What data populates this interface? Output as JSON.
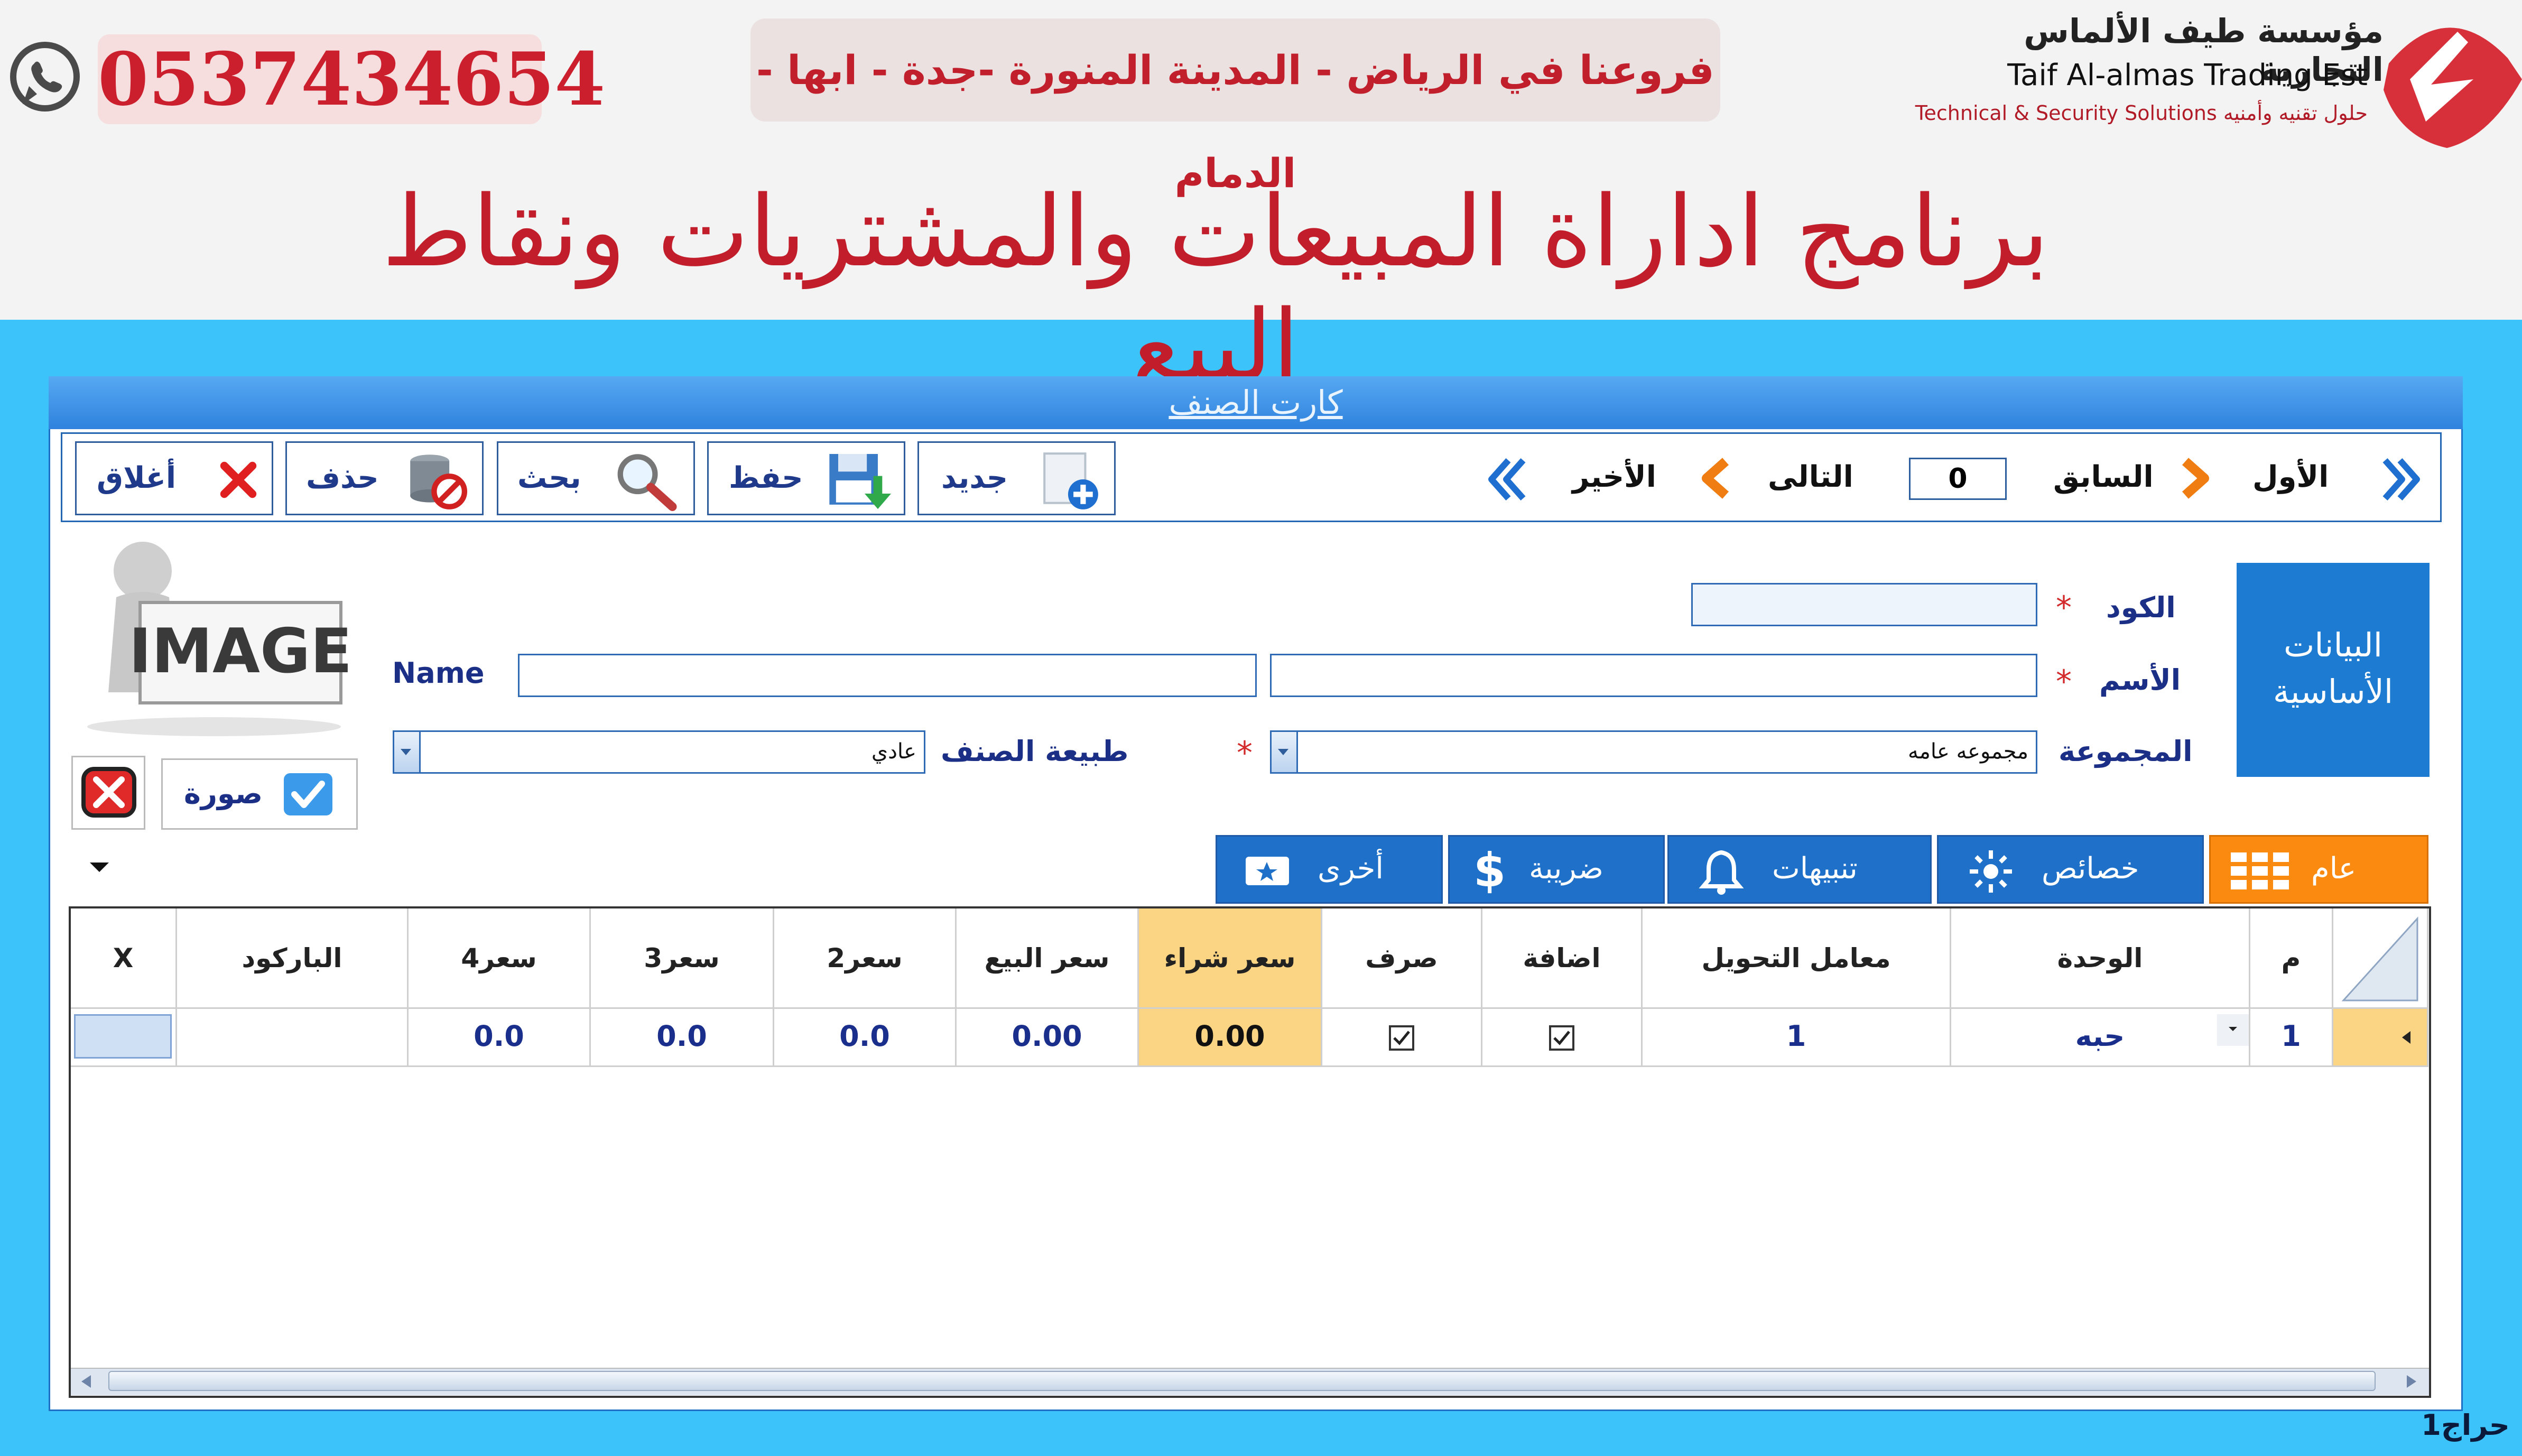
{
  "header": {
    "phone": "0537434654",
    "branches": "فروعنا في الرياض - المدينة المنورة -جدة - ابها - الدمام",
    "company_ar": "مؤسسة طيف الألماس التجارية",
    "company_en": "Taif Al-almas Trading Est",
    "company_tagline": "Technical & Security Solutions حلول تقنيه وأمنيه",
    "main_title": "برنامج اداراة المبيعات والمشتريات ونقاط البيع",
    "colors": {
      "brand_red": "#c11d2a",
      "blue_bg": "#3cc3fa"
    }
  },
  "window": {
    "title": "كارت الصنف"
  },
  "toolbar": {
    "close_label": "أغلاق",
    "delete_label": "حذف",
    "search_label": "بحث",
    "save_label": "حفظ",
    "new_label": "جديد",
    "nav": {
      "last": "الأخير",
      "next": "التالى",
      "record_number": "0",
      "previous": "السابق",
      "first": "الأول"
    }
  },
  "form": {
    "section_label": "البيانات الأساسية",
    "code_label": "الكود",
    "code_value": "",
    "name_ar_label": "الأسم",
    "name_ar_value": "",
    "name_en_label": "Name",
    "name_en_value": "",
    "group_label": "المجموعة",
    "group_value": "مجموعه عامه",
    "item_type_label": "طبيعة الصنف",
    "item_type_value": "عادي",
    "image_text": "IMAGE",
    "photo_label": "صورة"
  },
  "tabs": [
    {
      "label": "عام",
      "icon": "grid-icon",
      "active": true
    },
    {
      "label": "خصائص",
      "icon": "sun-icon",
      "active": false
    },
    {
      "label": "تنبيهات",
      "icon": "bell-icon",
      "active": false
    },
    {
      "label": "ضريبة",
      "icon": "dollar-icon",
      "active": false
    },
    {
      "label": "أخرى",
      "icon": "ticket-icon",
      "active": false
    }
  ],
  "grid": {
    "columns": [
      "م",
      "الوحدة",
      "معامل التحويل",
      "اضافة",
      "صرف",
      "سعر شراء",
      "سعر البيع",
      "سعر2",
      "سعر3",
      "سعر4",
      "الباركود",
      "X"
    ],
    "rows": [
      {
        "index": "1",
        "unit": "حبه",
        "factor": "1",
        "add": true,
        "issue": true,
        "purchase_price": "0.00",
        "sale_price": "0.00",
        "price2": "0.0",
        "price3": "0.0",
        "price4": "0.0",
        "barcode": "",
        "x": ""
      }
    ]
  },
  "footer": {
    "label": "حراج1"
  }
}
